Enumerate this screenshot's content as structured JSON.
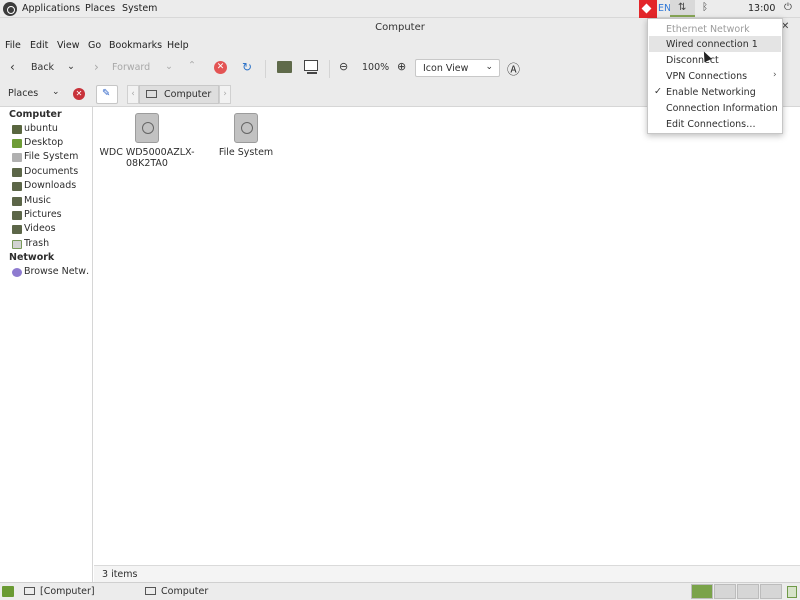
{
  "top_panel": {
    "menus": [
      "Applications",
      "Places",
      "System"
    ],
    "language": "EN",
    "clock": "13:00"
  },
  "window": {
    "title": "Computer"
  },
  "menubar": [
    "File",
    "Edit",
    "View",
    "Go",
    "Bookmarks",
    "Help"
  ],
  "toolbar": {
    "back_label": "Back",
    "forward_label": "Forward",
    "zoom_level": "100%",
    "view_mode": "Icon View"
  },
  "location_bar": {
    "places_label": "Places",
    "path_label": "Computer"
  },
  "sidebar": {
    "computer_header": "Computer",
    "computer_items": [
      "ubuntu",
      "Desktop",
      "File System",
      "Documents",
      "Downloads",
      "Music",
      "Pictures",
      "Videos",
      "Trash"
    ],
    "network_header": "Network",
    "network_items": [
      "Browse Netw…"
    ]
  },
  "files": [
    {
      "line1": "WDC WD5000AZLX-",
      "line2": "08K2TA0"
    },
    {
      "line1": "File System",
      "line2": ""
    }
  ],
  "status": {
    "text": "3 items"
  },
  "taskbar": {
    "tasks": [
      "[Computer]",
      "Computer"
    ]
  },
  "network_menu": {
    "items": [
      {
        "label": "Ethernet Network"
      },
      {
        "label": "Wired connection 1"
      },
      {
        "label": "Disconnect"
      },
      {
        "label": "VPN Connections"
      },
      {
        "label": "Enable Networking"
      },
      {
        "label": "Connection Information"
      },
      {
        "label": "Edit Connections…"
      }
    ]
  },
  "icons": {
    "accent": "#7aa34a",
    "anydesk": "#e3262a",
    "stop": "#e35454"
  }
}
